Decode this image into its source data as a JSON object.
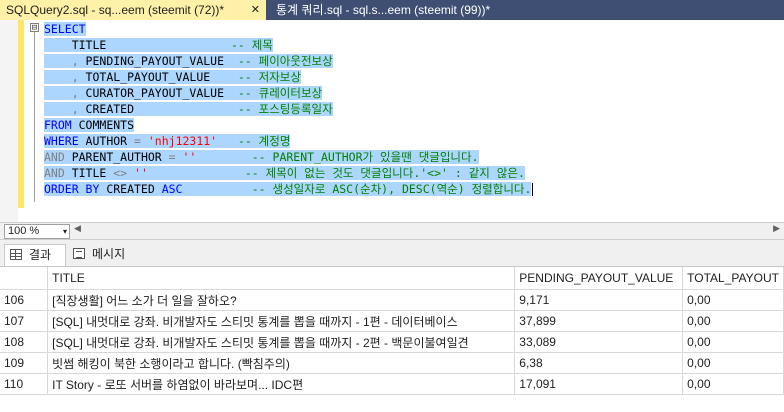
{
  "tabs": {
    "active": {
      "label": "SQLQuery2.sql - sq...eem (steemit (72))*",
      "close": "✕"
    },
    "inactive": {
      "label": "통계 쿼리.sql - sql.s...eem (steemit (99))*"
    }
  },
  "editor": {
    "fold_glyph": "⊟",
    "lines": [
      [
        {
          "t": "SELECT",
          "c": "kw"
        }
      ],
      [
        {
          "t": "    TITLE                  ",
          "c": "id"
        },
        {
          "t": "-- 제목",
          "c": "cm"
        }
      ],
      [
        {
          "t": "    , ",
          "c": "gr"
        },
        {
          "t": "PENDING_PAYOUT_VALUE  ",
          "c": "id"
        },
        {
          "t": "-- 페이아웃전보상",
          "c": "cm"
        }
      ],
      [
        {
          "t": "    , ",
          "c": "gr"
        },
        {
          "t": "TOTAL_PAYOUT_VALUE    ",
          "c": "id"
        },
        {
          "t": "-- 저자보상",
          "c": "cm"
        }
      ],
      [
        {
          "t": "    , ",
          "c": "gr"
        },
        {
          "t": "CURATOR_PAYOUT_VALUE  ",
          "c": "id"
        },
        {
          "t": "-- 큐레이터보상",
          "c": "cm"
        }
      ],
      [
        {
          "t": "    , ",
          "c": "gr"
        },
        {
          "t": "CREATED               ",
          "c": "id"
        },
        {
          "t": "-- 포스팅등록일자",
          "c": "cm"
        }
      ],
      [
        {
          "t": "FROM ",
          "c": "kw"
        },
        {
          "t": "COMMENTS",
          "c": "id"
        }
      ],
      [
        {
          "t": "WHERE ",
          "c": "kw"
        },
        {
          "t": "AUTHOR ",
          "c": "id"
        },
        {
          "t": "= ",
          "c": "gr"
        },
        {
          "t": "'nhj12311'",
          "c": "st"
        },
        {
          "t": "   ",
          "c": "id"
        },
        {
          "t": "-- 계정명",
          "c": "cm"
        }
      ],
      [
        {
          "t": "AND ",
          "c": "gr"
        },
        {
          "t": "PARENT_AUTHOR ",
          "c": "id"
        },
        {
          "t": "= ",
          "c": "gr"
        },
        {
          "t": "''",
          "c": "st"
        },
        {
          "t": "        ",
          "c": "id"
        },
        {
          "t": "-- PARENT_AUTHOR가 있을땐 댓글입니다.",
          "c": "cm"
        }
      ],
      [
        {
          "t": "AND ",
          "c": "gr"
        },
        {
          "t": "TITLE ",
          "c": "id"
        },
        {
          "t": "<> ",
          "c": "gr"
        },
        {
          "t": "''",
          "c": "st"
        },
        {
          "t": "              ",
          "c": "id"
        },
        {
          "t": "-- 제목이 없는 것도 댓글입니다.'<>' : 같지 않은.",
          "c": "cm"
        }
      ],
      [
        {
          "t": "ORDER BY ",
          "c": "kw"
        },
        {
          "t": "CREATED ",
          "c": "id"
        },
        {
          "t": "ASC",
          "c": "kw"
        },
        {
          "t": "          ",
          "c": "id"
        },
        {
          "t": "-- 생성일자로 ASC(순차), DESC(역순) 정렬합니다.",
          "c": "cm"
        }
      ]
    ]
  },
  "zoom": {
    "value": "100 %",
    "arrow": "▾"
  },
  "result_tabs": {
    "results": "결과",
    "messages": "메시지"
  },
  "grid": {
    "columns": [
      "",
      "TITLE",
      "PENDING_PAYOUT_VALUE",
      "TOTAL_PAYOUT"
    ],
    "rows": [
      [
        "106",
        "[직장생활] 어느 소가 더 일을 잘하오?",
        "9,171",
        "0,00"
      ],
      [
        "107",
        "[SQL] 내멋대로 강좌. 비개발자도 스티밋 통계를 뽑을 때까지 - 1편 - 데이터베이스",
        "37,899",
        "0,00"
      ],
      [
        "108",
        "[SQL] 내멋대로 강좌. 비개발자도 스티밋 통계를 뽑을 때까지 - 2편 - 백문이불여일견",
        "33,089",
        "0,00"
      ],
      [
        "109",
        "빗썸 해킹이 북한 소행이라고 합니다. (빡침주의)",
        "6,38",
        "0,00"
      ],
      [
        "110",
        "IT Story - 로또 서버를 하염없이 바라보며... IDC편",
        "17,091",
        "0,00"
      ]
    ]
  }
}
